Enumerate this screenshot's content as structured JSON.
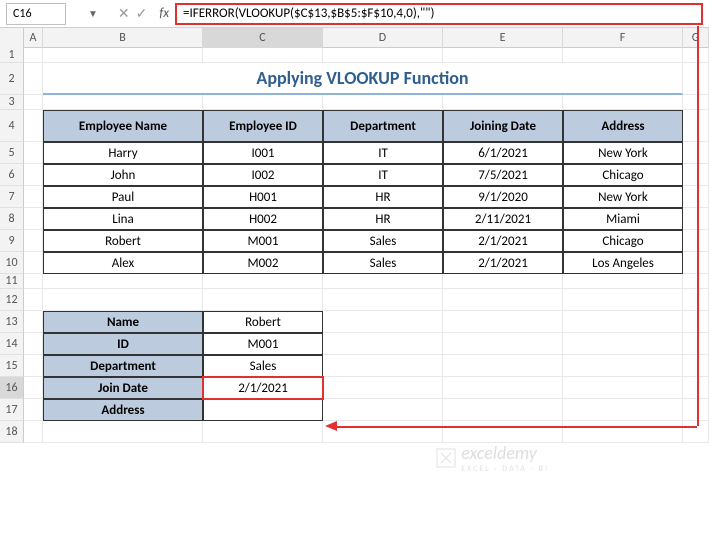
{
  "namebox": "C16",
  "formula": "=IFERROR(VLOOKUP($C$13,$B$5:$F$10,4,0),\"\")",
  "fx_label": "fx",
  "colheaders": [
    "A",
    "B",
    "C",
    "D",
    "E",
    "F",
    "G"
  ],
  "title": "Applying VLOOKUP Function",
  "table": {
    "headers": [
      "Employee Name",
      "Employee ID",
      "Department",
      "Joining Date",
      "Address"
    ],
    "rows": [
      [
        "Harry",
        "I001",
        "IT",
        "6/1/2021",
        "New York"
      ],
      [
        "John",
        "I002",
        "IT",
        "7/5/2021",
        "Chicago"
      ],
      [
        "Paul",
        "H001",
        "HR",
        "9/1/2020",
        "New York"
      ],
      [
        "Lina",
        "H002",
        "HR",
        "2/11/2021",
        "Miami"
      ],
      [
        "Robert",
        "M001",
        "Sales",
        "2/1/2021",
        "Chicago"
      ],
      [
        "Alex",
        "M002",
        "Sales",
        "2/1/2021",
        "Los Angeles"
      ]
    ]
  },
  "lookup": {
    "labels": [
      "Name",
      "ID",
      "Department",
      "Join Date",
      "Address"
    ],
    "values": [
      "Robert",
      "M001",
      "Sales",
      "2/1/2021",
      ""
    ]
  },
  "rownums": [
    "1",
    "2",
    "3",
    "4",
    "5",
    "6",
    "7",
    "8",
    "9",
    "10",
    "11",
    "12",
    "13",
    "14",
    "15",
    "16",
    "17",
    "18"
  ],
  "watermark": {
    "main": "exceldemy",
    "sub": "EXCEL · DATA · BI"
  }
}
